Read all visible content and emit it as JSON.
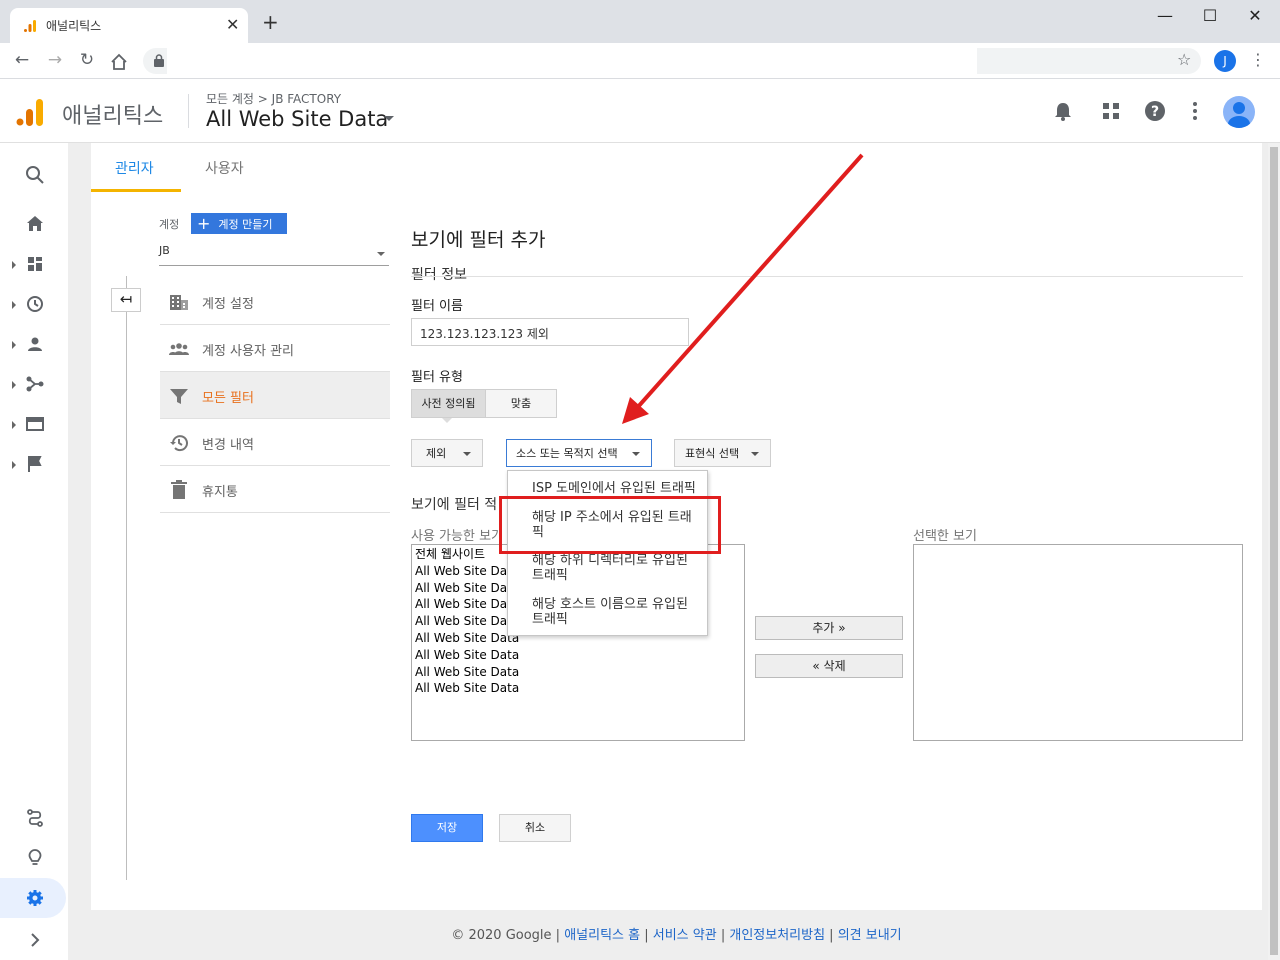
{
  "browser": {
    "tab_title": "애널리틱스",
    "tab_close": "✕",
    "new_tab": "+",
    "profile_initial": "J",
    "window_controls": {
      "minimize": "—",
      "maximize": "☐",
      "close": "✕"
    }
  },
  "header": {
    "app_name": "애널리틱스",
    "breadcrumb": "모든 계정 > JB FACTORY",
    "property": "All Web Site Data"
  },
  "admin_tabs": {
    "admin": "관리자",
    "user": "사용자"
  },
  "account": {
    "label": "계정",
    "create_button": "계정 만들기",
    "selected": "JB",
    "nav": [
      {
        "label": "계정 설정",
        "icon": "building-icon"
      },
      {
        "label": "계정 사용자 관리",
        "icon": "people-icon"
      },
      {
        "label": "모든 필터",
        "icon": "filter-icon"
      },
      {
        "label": "변경 내역",
        "icon": "history-icon"
      },
      {
        "label": "휴지통",
        "icon": "trash-icon"
      }
    ]
  },
  "form": {
    "title": "보기에 필터 추가",
    "section_info": "필터 정보",
    "filter_name_label": "필터 이름",
    "filter_name_value": "123.123.123.123 제외",
    "filter_type_label": "필터 유형",
    "type_predefined": "사전 정의됨",
    "type_custom": "맞춤",
    "dd_exclude": "제외",
    "dd_source": "소스 또는 목적지 선택",
    "dd_expression": "표현식 선택",
    "menu": {
      "item1": "ISP 도메인에서 유입된 트래픽",
      "item2_line1": "해당 IP 주소에서 유입된 트래",
      "item2_line2": "픽",
      "item3_line1": "해당 하위 디렉터리로 유입된",
      "item3_line2": "트래픽",
      "item4_line1": "해당 호스트 이름으로 유입된",
      "item4_line2": "트래픽"
    },
    "section_apply": "보기에 필터 적",
    "available_label": "사용 가능한 보기",
    "selected_label": "선택한 보기",
    "available_views": [
      "전체 웹사이트",
      "All Web Site Data",
      "All Web Site Data",
      "All Web Site Data",
      "All Web Site Data",
      "All Web Site Data",
      "All Web Site Data",
      "All Web Site Data",
      "All Web Site Data"
    ],
    "add_button": "추가 »",
    "remove_button": "« 삭제",
    "save_button": "저장",
    "cancel_button": "취소"
  },
  "footer": {
    "copyright": "© 2020 Google",
    "sep": " | ",
    "link_home": "애널리틱스 홈",
    "link_terms": "서비스 약관",
    "link_privacy": "개인정보처리방침",
    "link_feedback": "의견 보내기"
  },
  "colors": {
    "ga_orange": "#f9ab00",
    "accent_blue": "#1e88e5",
    "annotation_red": "#e01e1e",
    "active_filter": "#e8711e"
  }
}
